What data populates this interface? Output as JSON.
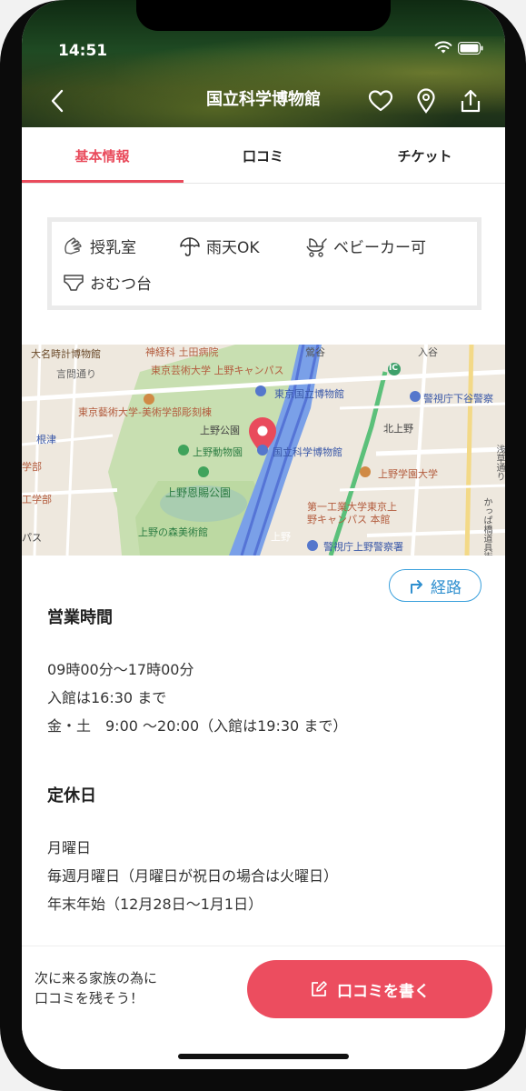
{
  "status": {
    "time": "14:51"
  },
  "header": {
    "title": "国立科学博物館"
  },
  "tabs": [
    {
      "label": "基本情報",
      "active": true
    },
    {
      "label": "口コミ",
      "active": false
    },
    {
      "label": "チケット",
      "active": false
    }
  ],
  "facilities": [
    {
      "label": "授乳室",
      "icon": "nursing-room-icon"
    },
    {
      "label": "雨天OK",
      "icon": "umbrella-icon"
    },
    {
      "label": "ベビーカー可",
      "icon": "stroller-icon"
    },
    {
      "label": "おむつ台",
      "icon": "diaper-icon"
    }
  ],
  "map": {
    "labels": [
      "大名時計博物館",
      "神経科 土田病院",
      "鶯谷",
      "入谷",
      "東京芸術大学 上野キャンパス",
      "言問通り",
      "東京国立博物館",
      "警視庁下谷警察",
      "東京藝術大学-美術学部彫刻棟",
      "上野公園",
      "北上野",
      "根津",
      "上野動物園",
      "国立科学博物館",
      "上野学園大学",
      "学部",
      "上野恩賜公園",
      "工学部",
      "第一工業大学東京上",
      "野キャンパス 本館",
      "上野の森美術館",
      "上野",
      "警視庁上野警察署",
      "パス",
      "かっぱ橋道具街通り",
      "浅草通り",
      "IC"
    ]
  },
  "route_button": {
    "label": "経路"
  },
  "hours": {
    "title": "営業時間",
    "lines": [
      "09時00分～17時00分",
      "入館は16:30 まで",
      "金・土　9:00 ～20:00（入館は19:30 まで）"
    ]
  },
  "closed": {
    "title": "定休日",
    "lines": [
      "月曜日",
      "毎週月曜日（月曜日が祝日の場合は火曜日）",
      "年末年始（12月28日～1月1日）"
    ]
  },
  "bottom": {
    "prompt_line1": "次に来る家族の為に",
    "prompt_line2": "口コミを残そう！",
    "button_label": "口コミを書く"
  },
  "colors": {
    "accent": "#ec4d5f",
    "link": "#3aa0dc"
  }
}
